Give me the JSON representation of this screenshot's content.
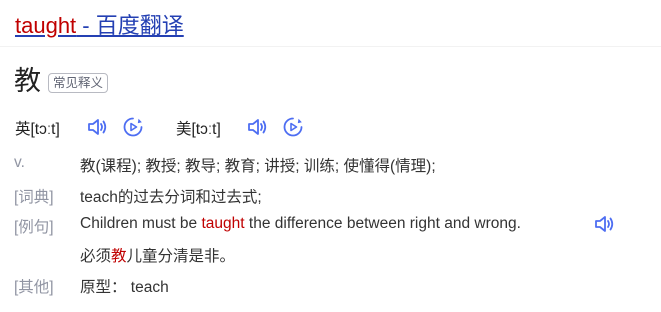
{
  "title": {
    "keyword": "taught",
    "suffix": " - 百度翻译"
  },
  "headword": "教",
  "headword_tag": "常见释义",
  "pronunciations": [
    {
      "label": "英[tɔːt]"
    },
    {
      "label": "美[tɔːt]"
    }
  ],
  "icons": {
    "speaker": "speaker-icon",
    "play": "play-circle-icon"
  },
  "colors": {
    "link": "#2440b3",
    "highlight": "#c00000",
    "icon": "#4e6ef2",
    "label": "#9195a3"
  },
  "definitions": {
    "pos": "v.",
    "text": "教(课程); 教授; 教导; 教育; 讲授; 训练; 使懂得(情理);"
  },
  "cidian": {
    "label": "[词典]",
    "text": "teach的过去分词和过去式;"
  },
  "example": {
    "label": "[例句]",
    "en_before": "Children must be ",
    "en_highlight": "taught",
    "en_after": " the difference between right and wrong.",
    "zh_before": "必须",
    "zh_highlight": "教",
    "zh_after": "儿童分清是非。"
  },
  "other": {
    "label": "[其他]",
    "text": "原型： teach"
  }
}
